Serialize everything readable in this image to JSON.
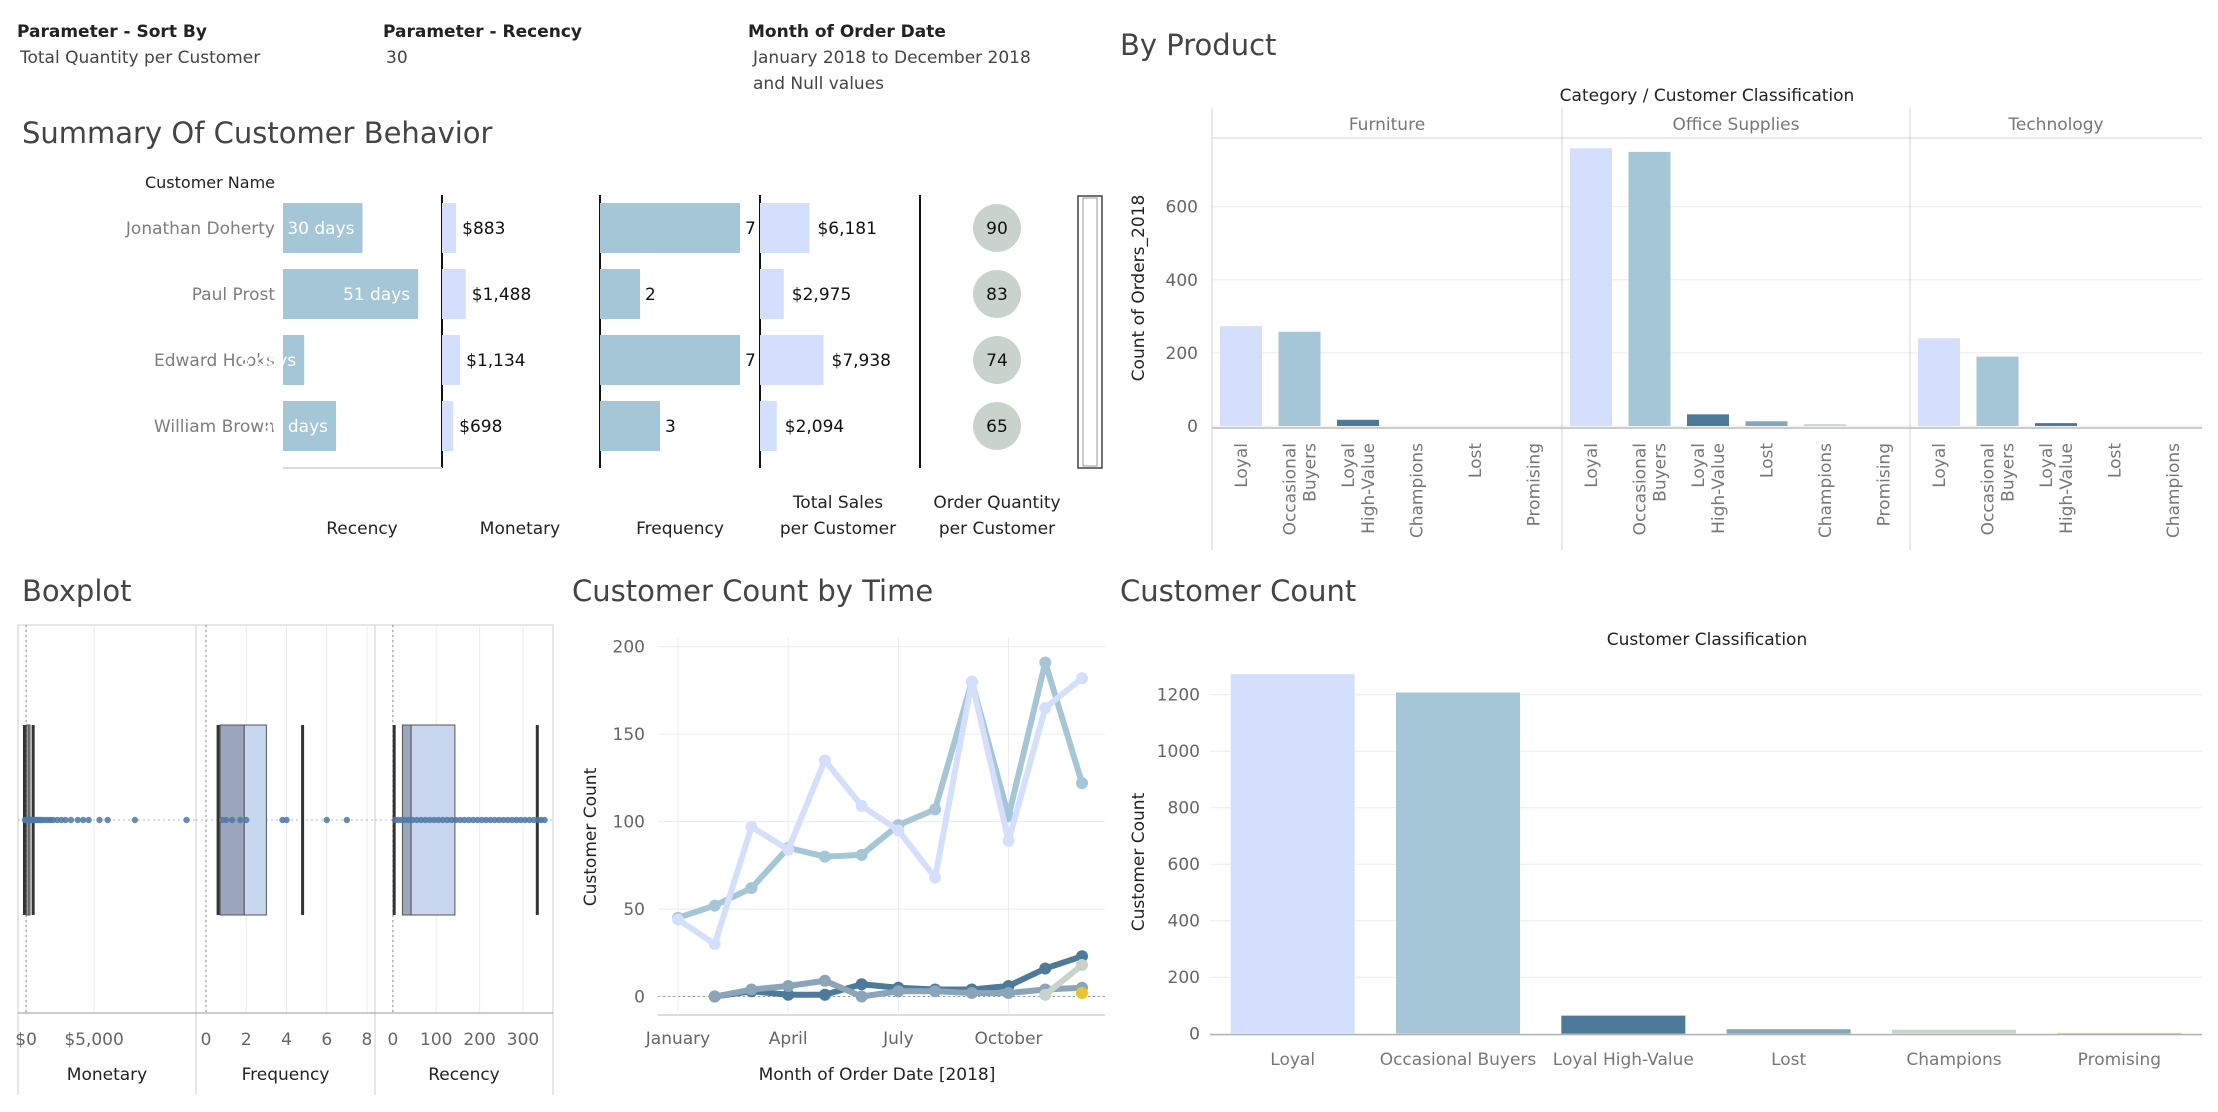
{
  "params": [
    {
      "label": "Parameter - Sort By",
      "value": "Total Quantity per Customer"
    },
    {
      "label": "Parameter - Recency",
      "value": "30"
    },
    {
      "label": "Month of Order Date",
      "value": "January 2018 to December 2018",
      "value2": "and Null values"
    }
  ],
  "titles": {
    "summary": "Summary Of Customer Behavior",
    "by_product": "By Product",
    "boxplot": "Boxplot",
    "count_time": "Customer Count by Time",
    "customer_count": "Customer Count"
  },
  "colors": {
    "loyal": "#d3dffc",
    "occasional": "#a5c6d6",
    "high_value": "#4e7a99",
    "lost": "#8aa5b8",
    "champions": "#c9d3cc",
    "promising": "#e8c334",
    "recency_bar": "#a5c6d6",
    "monetary_bar": "#d3dffc",
    "circle": "#c9d3cc"
  },
  "chart_data": [
    {
      "id": "summary",
      "type": "table",
      "row_header": "Customer Name",
      "columns": [
        "Recency",
        "Monetary",
        "Frequency",
        "Total Sales per Customer",
        "Order Quantity per Customer"
      ],
      "rows": [
        {
          "name": "Jonathan Doherty",
          "recency": 30,
          "recency_label": "30 days",
          "monetary": 883,
          "monetary_label": "$883",
          "frequency": 7,
          "frequency_label": "7",
          "sales": 6181,
          "sales_label": "$6,181",
          "quantity": 90,
          "quantity_label": "90"
        },
        {
          "name": "Paul Prost",
          "recency": 51,
          "recency_label": "51 days",
          "monetary": 1488,
          "monetary_label": "$1,488",
          "frequency": 2,
          "frequency_label": "2",
          "sales": 2975,
          "sales_label": "$2,975",
          "quantity": 83,
          "quantity_label": "83"
        },
        {
          "name": "Edward Hooks",
          "recency": 8,
          "recency_label": "8 days",
          "monetary": 1134,
          "monetary_label": "$1,134",
          "frequency": 7,
          "frequency_label": "7",
          "sales": 7938,
          "sales_label": "$7,938",
          "quantity": 74,
          "quantity_label": "74"
        },
        {
          "name": "William Brown",
          "recency": 20,
          "recency_label": "20 days",
          "monetary": 698,
          "monetary_label": "$698",
          "frequency": 3,
          "frequency_label": "3",
          "sales": 2094,
          "sales_label": "$2,094",
          "quantity": 65,
          "quantity_label": "65"
        }
      ]
    },
    {
      "id": "by_product",
      "type": "bar",
      "title": "Category / Customer Classification",
      "ylabel": "Count of Orders_2018",
      "ylim": [
        -30,
        870
      ],
      "yticks": [
        0,
        200,
        400,
        600
      ],
      "grid": true,
      "panels": [
        {
          "category": "Furniture",
          "categories": [
            "Loyal",
            "Occasional Buyers",
            "Loyal High-Value",
            "Champions",
            "Lost",
            "Promising"
          ],
          "values": [
            273,
            258,
            17,
            0,
            0,
            0
          ]
        },
        {
          "category": "Office Supplies",
          "categories": [
            "Loyal",
            "Occasional Buyers",
            "Loyal High-Value",
            "Lost",
            "Champions",
            "Promising"
          ],
          "values": [
            760,
            750,
            32,
            13,
            5,
            0
          ]
        },
        {
          "category": "Technology",
          "categories": [
            "Loyal",
            "Occasional Buyers",
            "Loyal High-Value",
            "Lost",
            "Champions"
          ],
          "values": [
            240,
            190,
            8,
            0,
            0
          ]
        }
      ]
    },
    {
      "id": "boxplot",
      "type": "scatter",
      "panels": [
        {
          "label": "Monetary",
          "ticks": [
            "$0",
            "$5,000"
          ],
          "tick_values": [
            0,
            5000
          ],
          "xlim": [
            -300,
            12200
          ],
          "q1": 40,
          "median": 200,
          "q3": 290,
          "whisker_low": -120,
          "whisker_high": 520,
          "points": [
            -80,
            0,
            60,
            110,
            180,
            260,
            330,
            410,
            480,
            560,
            660,
            780,
            900,
            1050,
            1200,
            1400,
            1600,
            1800,
            2000,
            2300,
            2600,
            2900,
            3300,
            3800,
            4200,
            4600,
            5400,
            6000,
            8000,
            11800
          ]
        },
        {
          "label": "Frequency",
          "ticks": [
            "0",
            "2",
            "4",
            "6",
            "8"
          ],
          "tick_values": [
            0,
            2,
            4,
            6,
            8
          ],
          "xlim": [
            -0.3,
            8.2
          ],
          "q1": 0.7,
          "median": 1.9,
          "q3": 3.0,
          "whisker_low": 0.6,
          "whisker_high": 4.8,
          "points": [
            0.8,
            1.0,
            1.3,
            1.7,
            2.0,
            3.8,
            4.0,
            6.0,
            7.0
          ]
        },
        {
          "label": "Recency",
          "ticks": [
            "0",
            "100",
            "200",
            "300"
          ],
          "tick_values": [
            0,
            100,
            200,
            300
          ],
          "xlim": [
            -32,
            360
          ],
          "q1": 22,
          "median": 42,
          "q3": 143,
          "whisker_low": 3,
          "whisker_high": 333,
          "points": [
            5,
            12,
            20,
            28,
            36,
            45,
            55,
            65,
            75,
            85,
            95,
            105,
            115,
            125,
            135,
            145,
            155,
            165,
            175,
            185,
            195,
            205,
            215,
            225,
            235,
            245,
            255,
            265,
            275,
            285,
            295,
            305,
            315,
            325,
            335,
            342,
            350
          ]
        }
      ]
    },
    {
      "id": "count_time",
      "type": "line",
      "xlabel": "Month of Order Date [2018]",
      "ylabel": "Customer Count",
      "ylim": [
        -10,
        205
      ],
      "yticks": [
        0,
        50,
        100,
        150,
        200
      ],
      "x": [
        1,
        2,
        3,
        4,
        5,
        6,
        7,
        8,
        9,
        10,
        11,
        12
      ],
      "xtick_labels": [
        {
          "month": 1,
          "label": "January"
        },
        {
          "month": 4,
          "label": "April"
        },
        {
          "month": 7,
          "label": "July"
        },
        {
          "month": 10,
          "label": "October"
        }
      ],
      "series": [
        {
          "color_key": "occasional",
          "x": [
            1,
            2,
            3,
            4,
            5,
            6,
            7,
            8,
            9,
            10,
            11,
            12
          ],
          "values": [
            45,
            52,
            62,
            85,
            80,
            81,
            98,
            107,
            180,
            103,
            191,
            122
          ]
        },
        {
          "color_key": "loyal",
          "x": [
            1,
            2,
            3,
            4,
            5,
            6,
            7,
            8,
            9,
            10,
            11,
            12
          ],
          "values": [
            44,
            30,
            97,
            84,
            135,
            109,
            95,
            68,
            180,
            89,
            165,
            182
          ]
        },
        {
          "color_key": "high_value",
          "x": [
            2,
            3,
            4,
            5,
            6,
            7,
            8,
            9,
            10,
            11,
            12
          ],
          "values": [
            0,
            3,
            1,
            1,
            7,
            5,
            4,
            4,
            6,
            16,
            23
          ]
        },
        {
          "color_key": "lost",
          "x": [
            2,
            3,
            4,
            5,
            6,
            7,
            8,
            9,
            10,
            11,
            12
          ],
          "values": [
            0,
            4,
            6,
            9,
            0,
            3,
            3,
            2,
            2,
            4,
            5
          ]
        },
        {
          "color_key": "champions",
          "x": [
            11,
            12
          ],
          "values": [
            1,
            18
          ]
        },
        {
          "color_key": "promising",
          "x": [
            12
          ],
          "values": [
            2
          ]
        }
      ]
    },
    {
      "id": "customer_count",
      "type": "bar",
      "title": "Customer Classification",
      "ylabel": "Customer Count",
      "ylim": [
        -40,
        1330
      ],
      "yticks": [
        0,
        200,
        400,
        600,
        800,
        1000,
        1200
      ],
      "categories": [
        "Loyal",
        "Occasional Buyers",
        "Loyal High-Value",
        "Lost",
        "Champions",
        "Promising"
      ],
      "values": [
        1273,
        1208,
        64,
        16,
        14,
        3
      ]
    }
  ]
}
